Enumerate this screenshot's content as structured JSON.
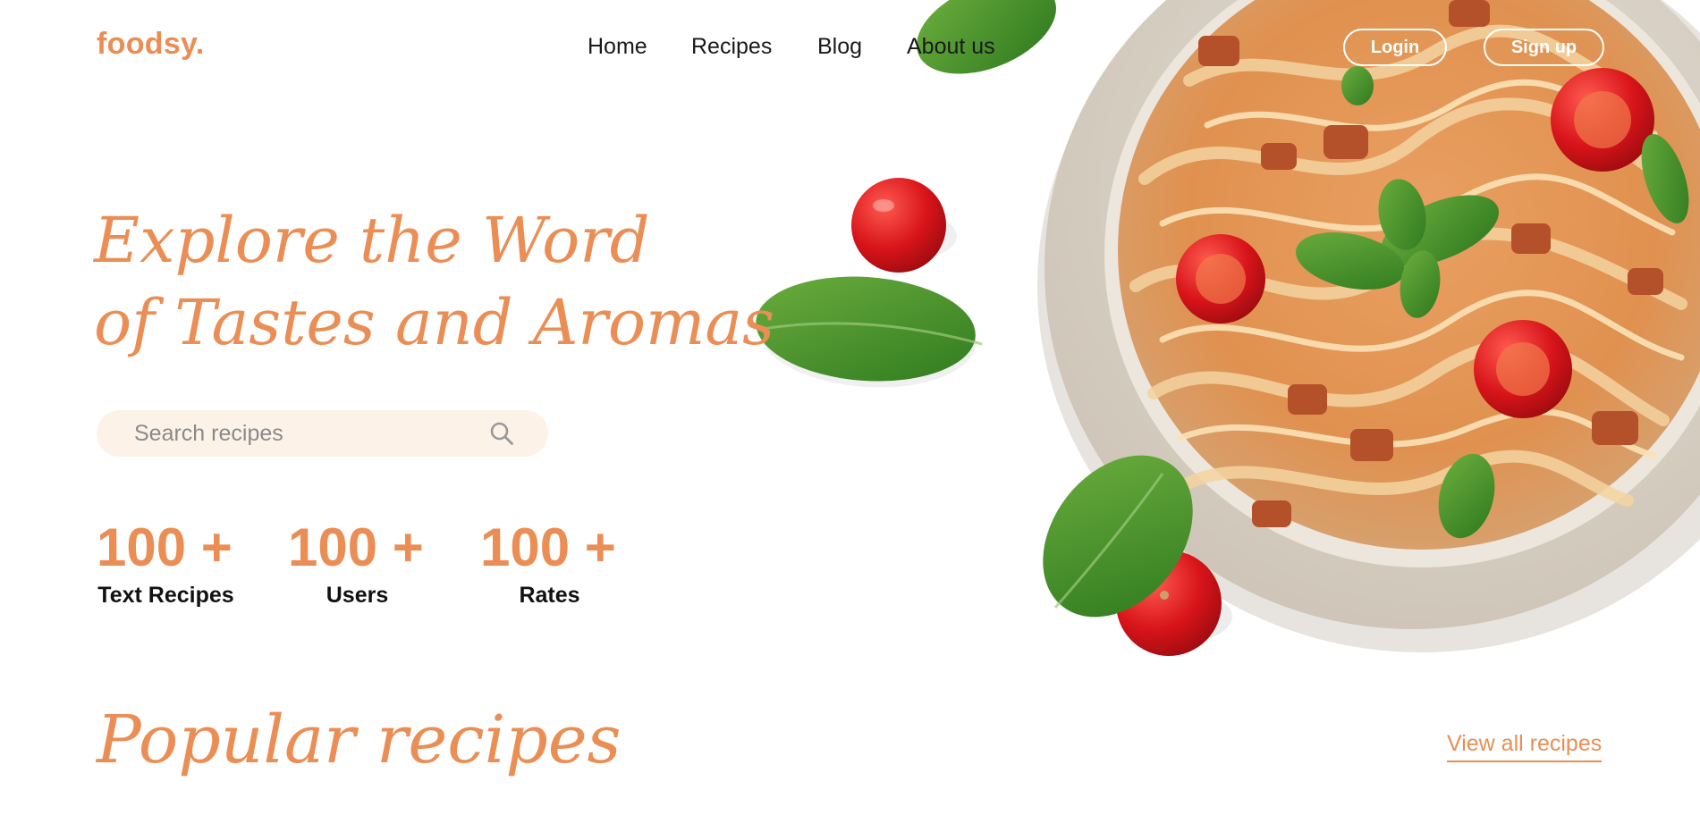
{
  "header": {
    "logo": "foodsy.",
    "nav": [
      "Home",
      "Recipes",
      "Blog",
      "About us"
    ],
    "login_label": "Login",
    "signup_label": "Sign up"
  },
  "hero": {
    "title_line1": "Explore the Word",
    "title_line2": "of Tastes and Aromas",
    "search_placeholder": "Search recipes"
  },
  "stats": [
    {
      "value": "100 +",
      "label": "Text Recipes"
    },
    {
      "value": "100 +",
      "label": "Users"
    },
    {
      "value": "100 +",
      "label": "Rates"
    }
  ],
  "popular": {
    "title": "Popular recipes",
    "view_all": "View all recipes"
  },
  "colors": {
    "accent": "#ea8e55",
    "search_bg": "#fdf2e8",
    "text": "#111111"
  },
  "icons": {
    "search": "search-icon"
  }
}
